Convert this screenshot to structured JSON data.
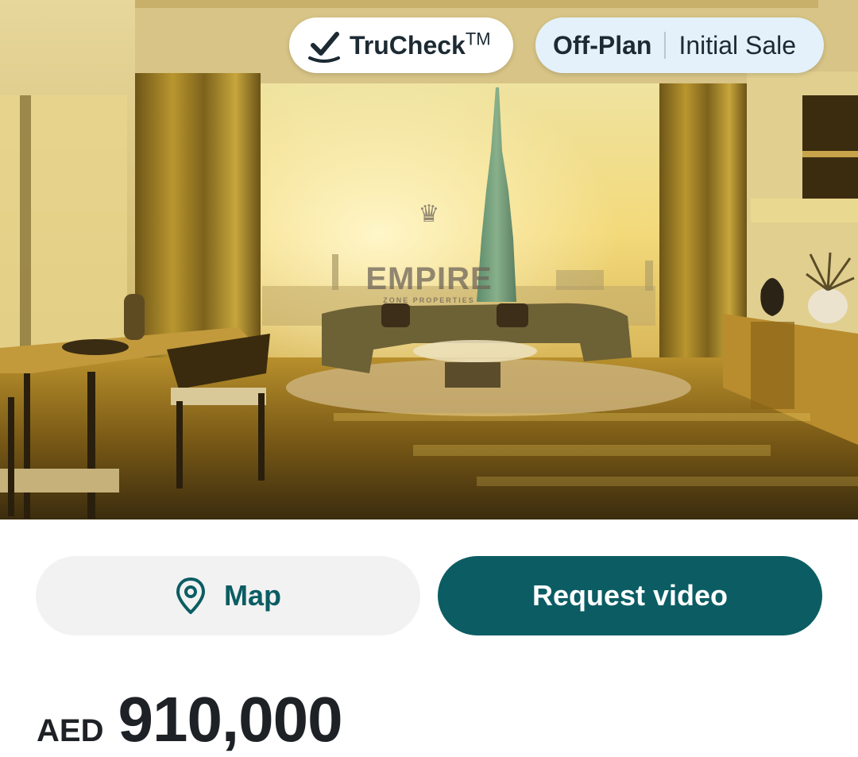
{
  "hero": {
    "watermark": {
      "crown_icon": "crown-icon",
      "name": "EMPIRE",
      "tagline": "ZONE PROPERTIES"
    }
  },
  "badges": {
    "trucheck": {
      "icon": "check-icon",
      "label": "TruCheck",
      "trademark": "TM"
    },
    "status": {
      "primary": "Off-Plan",
      "secondary": "Initial Sale"
    }
  },
  "actions": {
    "map": {
      "icon": "map-pin-icon",
      "label": "Map"
    },
    "request_video": {
      "label": "Request video"
    }
  },
  "listing": {
    "currency": "AED",
    "price": "910,000"
  },
  "colors": {
    "accent": "#0b5d63",
    "map_button_bg": "#f2f2f2",
    "status_pill_bg": "#e4f1fa",
    "text_dark": "#1e2226"
  }
}
